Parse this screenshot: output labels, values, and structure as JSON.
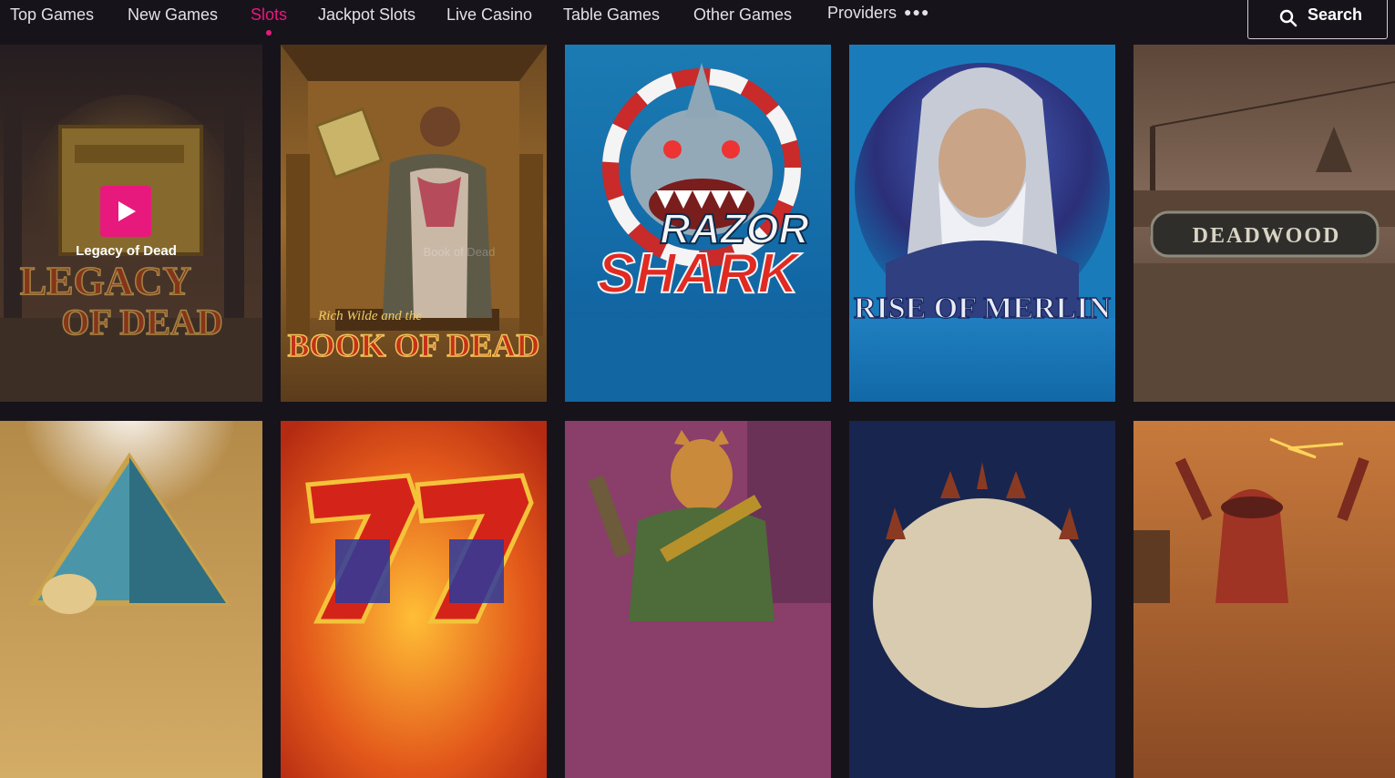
{
  "nav": {
    "items": [
      {
        "label": "Top Games"
      },
      {
        "label": "New Games"
      },
      {
        "label": "Slots",
        "active": true
      },
      {
        "label": "Jackpot Slots"
      },
      {
        "label": "Live Casino"
      },
      {
        "label": "Table Games"
      },
      {
        "label": "Other Games"
      },
      {
        "label": "Providers"
      }
    ],
    "more_icon": "ellipsis-icon",
    "search_label": "Search",
    "search_icon": "search-icon"
  },
  "colors": {
    "background": "#17131b",
    "accent": "#e8197d",
    "nav_text": "#e3e0e6"
  },
  "games": {
    "row1": [
      {
        "art_title_1": "LEGACY",
        "art_title_2": "OF DEAD",
        "hover_name": "Legacy of Dead",
        "play_icon": "play-icon"
      },
      {
        "art_subtitle": "Rich Wilde and the",
        "art_title": "BOOK OF DEAD",
        "ghost_name": "Book of Dead"
      },
      {
        "art_title_1": "RAZOR",
        "art_title_2": "SHARK"
      },
      {
        "art_title": "RISE OF MERLIN"
      },
      {
        "art_title": "DEADWOOD"
      }
    ]
  }
}
